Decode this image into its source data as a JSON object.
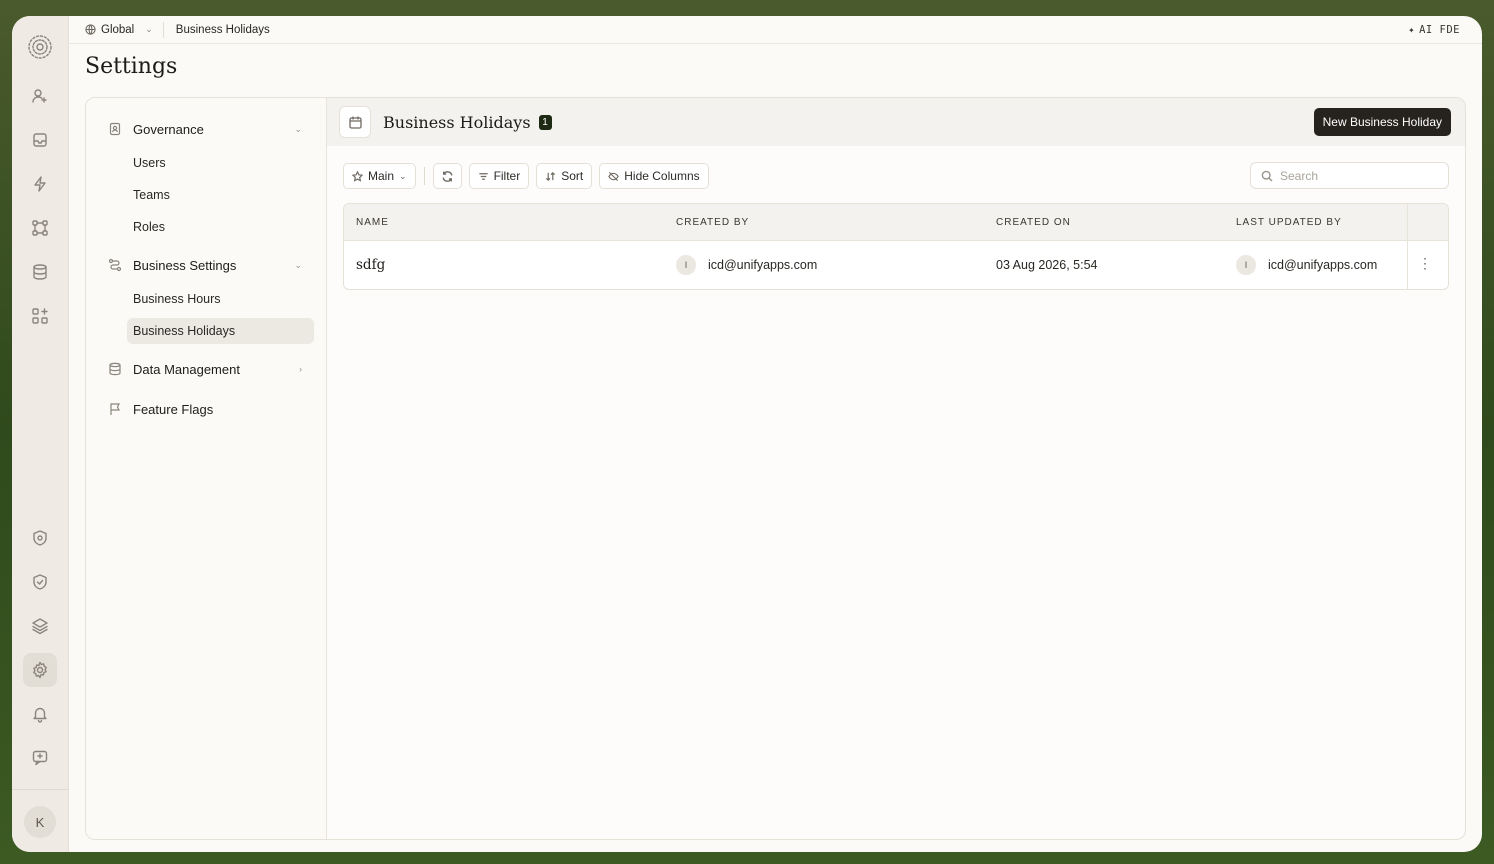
{
  "topbar": {
    "scope_label": "Global",
    "breadcrumb": "Business Holidays",
    "ai_label": "AI FDE"
  },
  "page": {
    "title": "Settings"
  },
  "rail": {
    "icons": [
      "logo-icon",
      "user-plus-icon",
      "inbox-icon",
      "bolt-icon",
      "workflow-icon",
      "database-icon",
      "apps-icon",
      "shield-outline-icon",
      "shield-check-icon",
      "layers-icon",
      "gear-icon",
      "bell-icon",
      "feedback-icon"
    ],
    "avatar_initial": "K"
  },
  "settings_nav": {
    "governance": {
      "label": "Governance",
      "items": [
        "Users",
        "Teams",
        "Roles"
      ]
    },
    "business_settings": {
      "label": "Business Settings",
      "items": [
        "Business Hours",
        "Business Holidays"
      ],
      "active": "Business Holidays"
    },
    "data_management": {
      "label": "Data Management"
    },
    "feature_flags": {
      "label": "Feature Flags"
    }
  },
  "content": {
    "title": "Business Holidays",
    "count": "1",
    "new_button": "New Business Holiday",
    "toolbar": {
      "view": "Main",
      "filter": "Filter",
      "sort": "Sort",
      "hide_columns": "Hide Columns",
      "search_placeholder": "Search"
    },
    "table": {
      "columns": [
        "NAME",
        "CREATED BY",
        "CREATED ON",
        "LAST UPDATED BY"
      ],
      "rows": [
        {
          "name": "sdfg",
          "created_by_initial": "I",
          "created_by": "icd@unifyapps.com",
          "created_on": "03 Aug 2026, 5:54",
          "updated_by_initial": "I",
          "updated_by": "icd@unifyapps.com"
        }
      ]
    }
  }
}
